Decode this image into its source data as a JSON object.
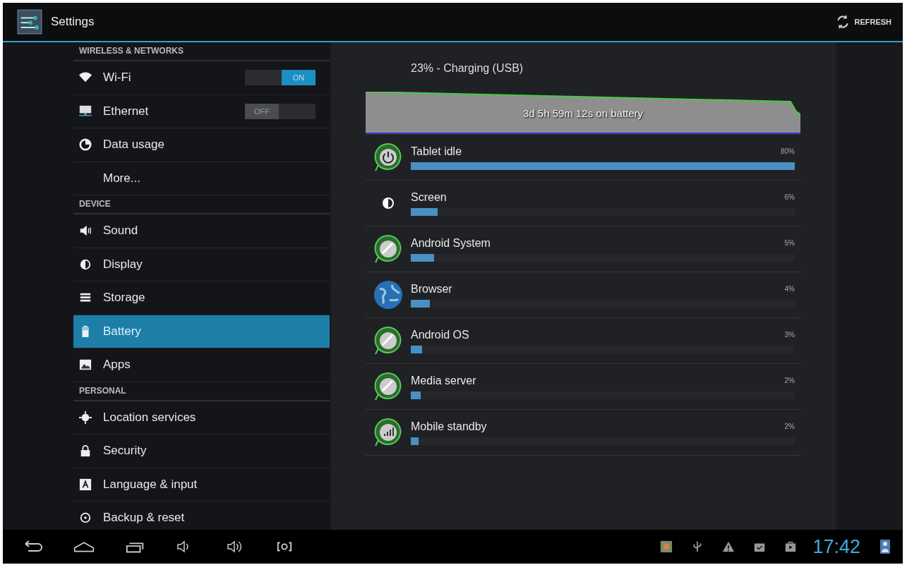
{
  "action_bar": {
    "title": "Settings",
    "refresh": "REFRESH"
  },
  "sidebar": {
    "items": [
      {
        "kind": "header",
        "label": "WIRELESS & NETWORKS"
      },
      {
        "kind": "toggle",
        "label": "Wi-Fi",
        "on": true,
        "switch_label": "ON",
        "selected": false
      },
      {
        "kind": "toggle",
        "label": "Ethernet",
        "on": false,
        "switch_label": "OFF",
        "selected": false
      },
      {
        "kind": "item",
        "label": "Data usage",
        "selected": false
      },
      {
        "kind": "item",
        "label": "More...",
        "selected": false
      },
      {
        "kind": "header",
        "label": "DEVICE"
      },
      {
        "kind": "item",
        "label": "Sound",
        "selected": false
      },
      {
        "kind": "item",
        "label": "Display",
        "selected": false
      },
      {
        "kind": "item",
        "label": "Storage",
        "selected": false
      },
      {
        "kind": "item",
        "label": "Battery",
        "selected": true
      },
      {
        "kind": "item",
        "label": "Apps",
        "selected": false
      },
      {
        "kind": "header",
        "label": "PERSONAL"
      },
      {
        "kind": "item",
        "label": "Location services",
        "selected": false
      },
      {
        "kind": "item",
        "label": "Security",
        "selected": false
      },
      {
        "kind": "item",
        "label": "Language & input",
        "selected": false
      },
      {
        "kind": "item",
        "label": "Backup & reset",
        "selected": false
      }
    ]
  },
  "battery": {
    "status": "23% - Charging (USB)",
    "graph_label": "3d 5h 59m 12s on battery",
    "usage": [
      {
        "name": "Tablet idle",
        "percent": "80%",
        "level": 1.0
      },
      {
        "name": "Screen",
        "percent": "6%",
        "level": 0.07
      },
      {
        "name": "Android System",
        "percent": "5%",
        "level": 0.06
      },
      {
        "name": "Browser",
        "percent": "4%",
        "level": 0.05
      },
      {
        "name": "Android OS",
        "percent": "3%",
        "level": 0.03
      },
      {
        "name": "Media server",
        "percent": "2%",
        "level": 0.025
      },
      {
        "name": "Mobile standby",
        "percent": "2%",
        "level": 0.02
      }
    ]
  },
  "status_bar": {
    "time": "17:42"
  }
}
